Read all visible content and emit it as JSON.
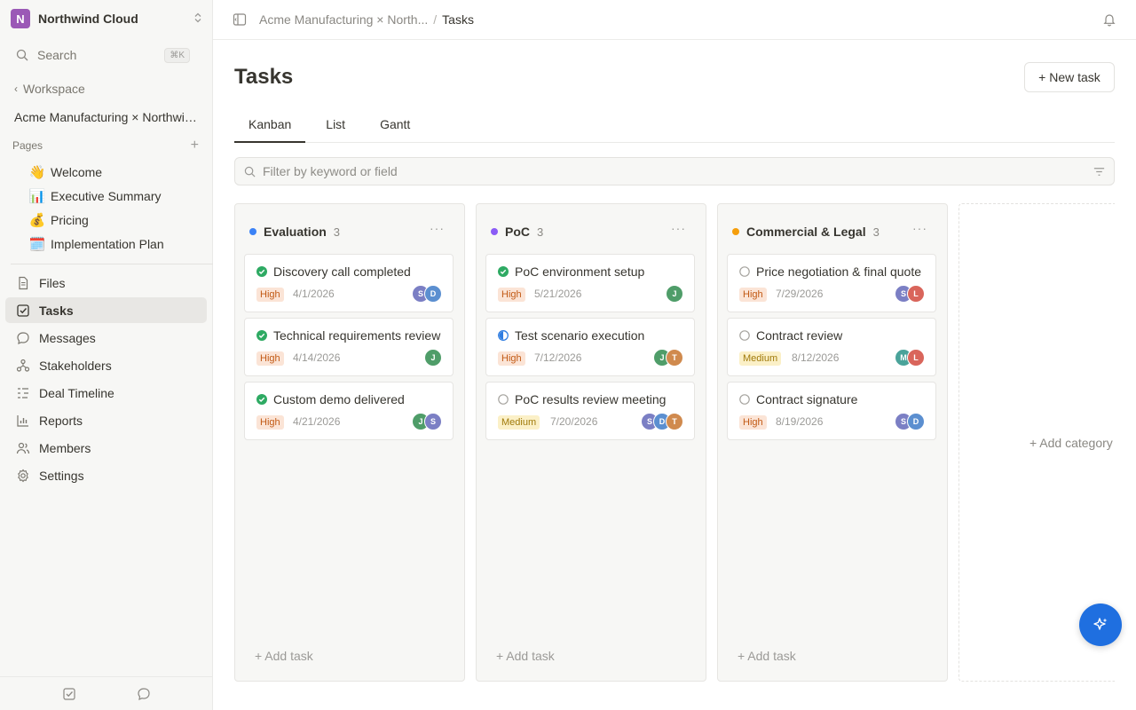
{
  "sidebar": {
    "workspace_initial": "N",
    "workspace_name": "Northwind Cloud",
    "search_label": "Search",
    "search_shortcut": "⌘K",
    "back_label": "Workspace",
    "project_name": "Acme Manufacturing × Northwind Cloud",
    "pages_header": "Pages",
    "pages": [
      {
        "emoji": "👋",
        "label": "Welcome"
      },
      {
        "emoji": "📊",
        "label": "Executive Summary"
      },
      {
        "emoji": "💰",
        "label": "Pricing"
      },
      {
        "emoji": "🗓️",
        "label": "Implementation Plan"
      }
    ],
    "nav": [
      {
        "label": "Files",
        "icon": "file-icon"
      },
      {
        "label": "Tasks",
        "icon": "task-check-icon",
        "active": true
      },
      {
        "label": "Messages",
        "icon": "message-icon"
      },
      {
        "label": "Stakeholders",
        "icon": "org-chart-icon"
      },
      {
        "label": "Deal Timeline",
        "icon": "timeline-icon"
      },
      {
        "label": "Reports",
        "icon": "bar-chart-icon"
      },
      {
        "label": "Members",
        "icon": "members-icon"
      },
      {
        "label": "Settings",
        "icon": "gear-icon"
      }
    ]
  },
  "topbar": {
    "breadcrumb_project": "Acme Manufacturing × North...",
    "breadcrumb_separator": "/",
    "breadcrumb_current": "Tasks"
  },
  "main": {
    "title": "Tasks",
    "new_task_label": "+ New task",
    "tabs": [
      {
        "label": "Kanban",
        "active": true
      },
      {
        "label": "List"
      },
      {
        "label": "Gantt"
      }
    ],
    "filter_placeholder": "Filter by keyword or field",
    "add_category_label": "+ Add category"
  },
  "colors": {
    "evaluation": "#3b82f6",
    "poc": "#8b5cf6",
    "commercial": "#f59e0b",
    "done_green": "#2eaa63",
    "fab_blue": "#1f6fe0"
  },
  "board": {
    "add_task_label": "+ Add task",
    "more_label": "···",
    "columns": [
      {
        "name": "Evaluation",
        "count": "3",
        "color": "#3b82f6",
        "cards": [
          {
            "title": "Discovery call completed",
            "status": "done",
            "priority": "High",
            "date": "4/1/2026",
            "assignees": [
              {
                "i": "S",
                "c": "#7b7fc4"
              },
              {
                "i": "D",
                "c": "#5b8fd0"
              }
            ]
          },
          {
            "title": "Technical requirements review",
            "status": "done",
            "priority": "High",
            "date": "4/14/2026",
            "assignees": [
              {
                "i": "J",
                "c": "#4f9d69"
              }
            ]
          },
          {
            "title": "Custom demo delivered",
            "status": "done",
            "priority": "High",
            "date": "4/21/2026",
            "assignees": [
              {
                "i": "J",
                "c": "#4f9d69"
              },
              {
                "i": "S",
                "c": "#7b7fc4"
              }
            ]
          }
        ]
      },
      {
        "name": "PoC",
        "count": "3",
        "color": "#8b5cf6",
        "cards": [
          {
            "title": "PoC environment setup",
            "status": "done",
            "priority": "High",
            "date": "5/21/2026",
            "assignees": [
              {
                "i": "J",
                "c": "#4f9d69"
              }
            ]
          },
          {
            "title": "Test scenario execution",
            "status": "in-progress",
            "priority": "High",
            "date": "7/12/2026",
            "assignees": [
              {
                "i": "J",
                "c": "#4f9d69"
              },
              {
                "i": "T",
                "c": "#d08a4e"
              }
            ]
          },
          {
            "title": "PoC results review meeting",
            "status": "todo",
            "priority": "Medium",
            "date": "7/20/2026",
            "assignees": [
              {
                "i": "S",
                "c": "#7b7fc4"
              },
              {
                "i": "D",
                "c": "#5b8fd0"
              },
              {
                "i": "T",
                "c": "#d08a4e"
              }
            ]
          }
        ]
      },
      {
        "name": "Commercial & Legal",
        "count": "3",
        "color": "#f59e0b",
        "cards": [
          {
            "title": "Price negotiation & final quote",
            "status": "todo",
            "priority": "High",
            "date": "7/29/2026",
            "assignees": [
              {
                "i": "S",
                "c": "#7b7fc4"
              },
              {
                "i": "L",
                "c": "#d9655b"
              }
            ]
          },
          {
            "title": "Contract review",
            "status": "todo",
            "priority": "Medium",
            "date": "8/12/2026",
            "assignees": [
              {
                "i": "M",
                "c": "#4aa39a"
              },
              {
                "i": "L",
                "c": "#d9655b"
              }
            ]
          },
          {
            "title": "Contract signature",
            "status": "todo",
            "priority": "High",
            "date": "8/19/2026",
            "assignees": [
              {
                "i": "S",
                "c": "#7b7fc4"
              },
              {
                "i": "D",
                "c": "#5b8fd0"
              }
            ]
          }
        ]
      }
    ]
  }
}
